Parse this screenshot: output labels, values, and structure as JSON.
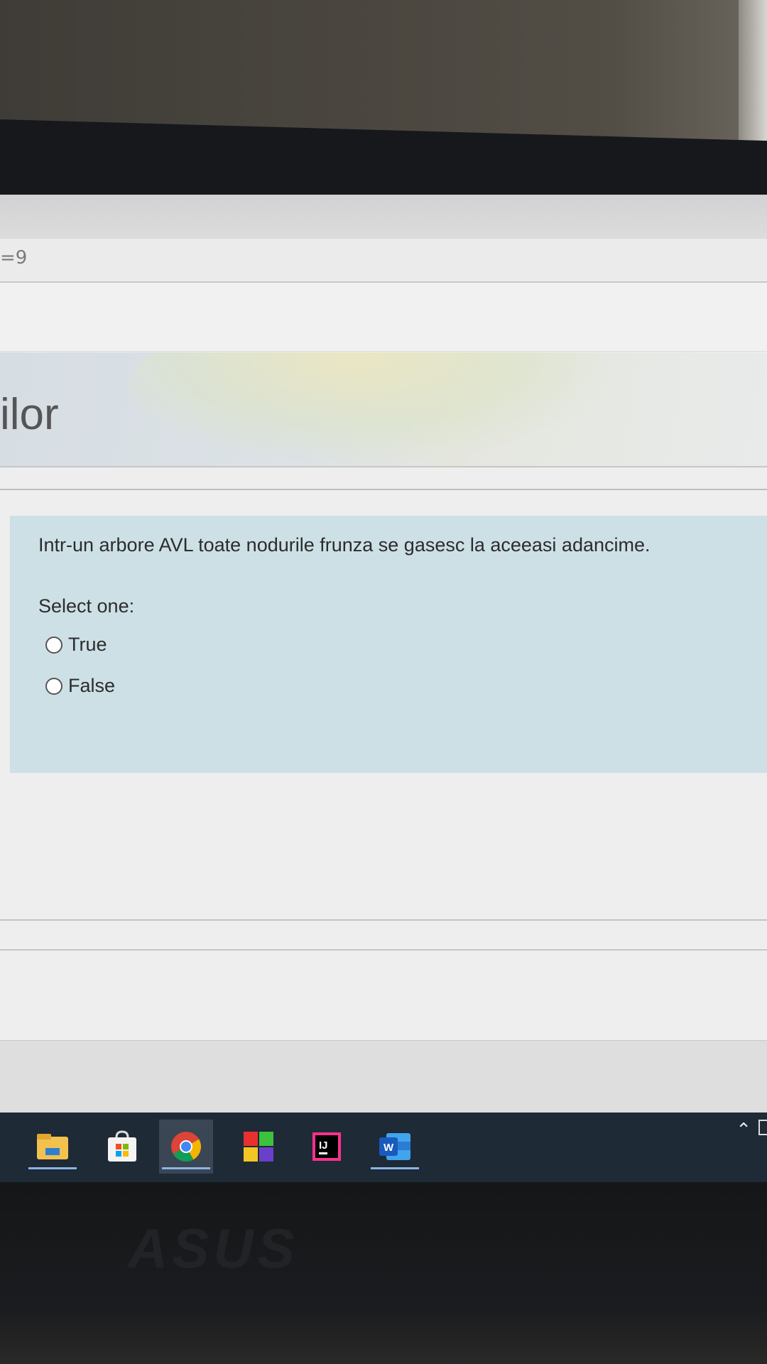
{
  "browser": {
    "url_fragment": "=9"
  },
  "header": {
    "title_fragment": "ilor"
  },
  "question": {
    "text": "Intr-un arbore AVL toate nodurile frunza se gasesc la aceeasi adancime.",
    "select_label": "Select one:",
    "options": [
      {
        "label": "True"
      },
      {
        "label": "False"
      }
    ]
  },
  "taskbar": {
    "apps": [
      {
        "icon": "file-explorer-icon"
      },
      {
        "icon": "microsoft-store-icon"
      },
      {
        "icon": "chrome-icon"
      },
      {
        "icon": "tiles-app-icon"
      },
      {
        "icon": "intellij-icon",
        "label": "IJ"
      },
      {
        "icon": "word-icon",
        "label": "W"
      }
    ]
  },
  "bezel": {
    "brand": "ASUS"
  },
  "colors": {
    "question_bg": "#cde0e6",
    "taskbar_bg": "#1e2a36",
    "active_underline": "#8ab4e8"
  }
}
